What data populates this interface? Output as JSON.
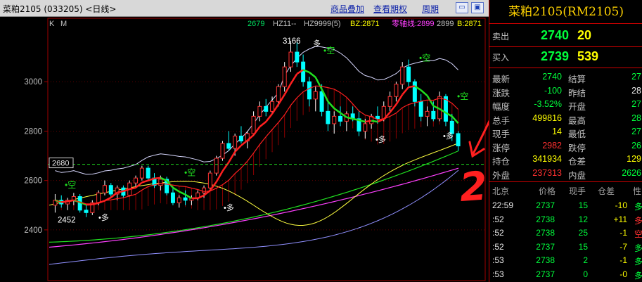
{
  "window": {
    "title": "菜粕2105 (033205) <日线>",
    "buttons": [
      "商品叠加",
      "查看期权",
      "周期"
    ],
    "icon_buttons": [
      "zoom-out-icon",
      "zoom-in-icon"
    ]
  },
  "indicator_bar": {
    "left": "K",
    "left2": "M",
    "values": [
      {
        "text": "2679",
        "color": "#00e060"
      },
      {
        "text": "HZ11--",
        "color": "#c0c0c0"
      },
      {
        "text": "HZ9999(5)",
        "color": "#c0c0c0"
      },
      {
        "text": "BZ:2871",
        "color": "#ffff00"
      },
      {
        "text": "零轴线:2899",
        "color": "#ff40ff"
      },
      {
        "text": "2899",
        "color": "#c0c0c0"
      },
      {
        "text": "B:2871",
        "color": "#ffff00"
      }
    ]
  },
  "chart_data": {
    "type": "candlestick",
    "y_ticks": [
      3000,
      2800,
      2600,
      2400
    ],
    "ylim": [
      2300,
      3200
    ],
    "price_box": "2680",
    "annotations": {
      "high": "3166",
      "low": "2452",
      "kong": "空",
      "duo": "多",
      "handwritten": "2680"
    },
    "candles": [
      [
        2500,
        2545,
        2470,
        2520
      ],
      [
        2520,
        2540,
        2490,
        2505
      ],
      [
        2505,
        2530,
        2480,
        2520
      ],
      [
        2520,
        2550,
        2500,
        2535
      ],
      [
        2535,
        2545,
        2470,
        2480
      ],
      [
        2480,
        2500,
        2452,
        2470
      ],
      [
        2470,
        2520,
        2460,
        2510
      ],
      [
        2510,
        2560,
        2500,
        2550
      ],
      [
        2550,
        2600,
        2540,
        2580
      ],
      [
        2580,
        2590,
        2530,
        2545
      ],
      [
        2545,
        2580,
        2520,
        2570
      ],
      [
        2570,
        2580,
        2530,
        2540
      ],
      [
        2540,
        2600,
        2535,
        2590
      ],
      [
        2590,
        2620,
        2570,
        2610
      ],
      [
        2610,
        2660,
        2600,
        2650
      ],
      [
        2650,
        2660,
        2600,
        2610
      ],
      [
        2610,
        2630,
        2570,
        2580
      ],
      [
        2580,
        2620,
        2560,
        2605
      ],
      [
        2605,
        2615,
        2540,
        2550
      ],
      [
        2550,
        2570,
        2500,
        2510
      ],
      [
        2510,
        2540,
        2490,
        2530
      ],
      [
        2530,
        2560,
        2500,
        2520
      ],
      [
        2520,
        2540,
        2500,
        2530
      ],
      [
        2530,
        2560,
        2520,
        2550
      ],
      [
        2550,
        2580,
        2530,
        2570
      ],
      [
        2570,
        2640,
        2560,
        2630
      ],
      [
        2630,
        2700,
        2620,
        2690
      ],
      [
        2690,
        2760,
        2680,
        2750
      ],
      [
        2750,
        2800,
        2720,
        2730
      ],
      [
        2730,
        2790,
        2700,
        2780
      ],
      [
        2780,
        2820,
        2750,
        2760
      ],
      [
        2760,
        2800,
        2730,
        2790
      ],
      [
        2790,
        2880,
        2780,
        2860
      ],
      [
        2860,
        2920,
        2840,
        2900
      ],
      [
        2900,
        2930,
        2860,
        2880
      ],
      [
        2880,
        2940,
        2870,
        2920
      ],
      [
        2920,
        2990,
        2900,
        2980
      ],
      [
        2980,
        3080,
        2960,
        3060
      ],
      [
        3060,
        3166,
        3040,
        3120
      ],
      [
        3120,
        3160,
        3060,
        3080
      ],
      [
        3080,
        3110,
        2980,
        3000
      ],
      [
        3000,
        3020,
        2900,
        2930
      ],
      [
        2930,
        2980,
        2880,
        2960
      ],
      [
        2960,
        2990,
        2860,
        2880
      ],
      [
        2880,
        2920,
        2800,
        2830
      ],
      [
        2830,
        2880,
        2790,
        2860
      ],
      [
        2860,
        2900,
        2820,
        2840
      ],
      [
        2840,
        2880,
        2800,
        2870
      ],
      [
        2870,
        2900,
        2840,
        2850
      ],
      [
        2850,
        2880,
        2780,
        2800
      ],
      [
        2800,
        2850,
        2770,
        2830
      ],
      [
        2830,
        2870,
        2810,
        2860
      ],
      [
        2860,
        2900,
        2830,
        2850
      ],
      [
        2850,
        2920,
        2840,
        2900
      ],
      [
        2900,
        2960,
        2880,
        2940
      ],
      [
        2940,
        3000,
        2920,
        2990
      ],
      [
        2990,
        3080,
        2970,
        3060
      ],
      [
        3060,
        3090,
        2980,
        3000
      ],
      [
        3000,
        3010,
        2900,
        2920
      ],
      [
        2920,
        2950,
        2840,
        2860
      ],
      [
        2860,
        2900,
        2820,
        2880
      ],
      [
        2880,
        2920,
        2840,
        2850
      ],
      [
        2850,
        2960,
        2840,
        2940
      ],
      [
        2940,
        2950,
        2820,
        2840
      ],
      [
        2840,
        2870,
        2760,
        2790
      ],
      [
        2790,
        2800,
        2720,
        2740
      ]
    ]
  },
  "quote": {
    "title": "菜粕2105(RM2105)",
    "sell": {
      "label": "卖出",
      "price": "2740",
      "vol": "20"
    },
    "buy": {
      "label": "买入",
      "price": "2739",
      "vol": "539"
    },
    "stats": [
      {
        "l1": "最新",
        "v1": "2740",
        "c1": "green",
        "l2": "结算",
        "v2": "27",
        "c2": "green"
      },
      {
        "l1": "涨跌",
        "v1": "-100",
        "c1": "green",
        "l2": "昨结",
        "v2": "28",
        "c2": "white"
      },
      {
        "l1": "幅度",
        "v1": "-3.52%",
        "c1": "green",
        "l2": "开盘",
        "v2": "27",
        "c2": "green"
      },
      {
        "l1": "总手",
        "v1": "499816",
        "c1": "yellow",
        "l2": "最高",
        "v2": "28",
        "c2": "green"
      },
      {
        "l1": "现手",
        "v1": "14",
        "c1": "yellow",
        "l2": "最低",
        "v2": "27",
        "c2": "green"
      },
      {
        "l1": "涨停",
        "v1": "2982",
        "c1": "red",
        "l2": "跌停",
        "v2": "26",
        "c2": "green"
      },
      {
        "l1": "持仓",
        "v1": "341934",
        "c1": "yellow",
        "l2": "仓差",
        "v2": "129",
        "c2": "yellow"
      },
      {
        "l1": "外盘",
        "v1": "237313",
        "c1": "red",
        "l2": "内盘",
        "v2": "2626",
        "c2": "green"
      }
    ],
    "tick_header": [
      "北京",
      "价格",
      "现手",
      "仓差",
      "性"
    ],
    "ticks": [
      {
        "time": "22:59",
        "price": "2737",
        "vol": "15",
        "oi": "-10",
        "oi_c": "yellow",
        "t": "多",
        "t_c": "green"
      },
      {
        "time": ":52",
        "price": "2738",
        "vol": "12",
        "oi": "+11",
        "oi_c": "yellow",
        "t": "多",
        "t_c": "red"
      },
      {
        "time": ":52",
        "price": "2738",
        "vol": "25",
        "oi": "-1",
        "oi_c": "yellow",
        "t": "空",
        "t_c": "red"
      },
      {
        "time": ":52",
        "price": "2737",
        "vol": "15",
        "oi": "-7",
        "oi_c": "yellow",
        "t": "多",
        "t_c": "green"
      },
      {
        "time": ":53",
        "price": "2738",
        "vol": "2",
        "oi": "-1",
        "oi_c": "yellow",
        "t": "多",
        "t_c": "green"
      },
      {
        "time": ":53",
        "price": "2737",
        "vol": "0",
        "oi": "-0",
        "oi_c": "yellow",
        "t": "多",
        "t_c": "green"
      }
    ]
  },
  "colors": {
    "up": "#ff3030",
    "down": "#00ffff",
    "ma_yellow": "#ffff40",
    "ma_green": "#20e020",
    "ma_red": "#ff2020",
    "ma_purple": "#9090ff",
    "ma_magenta": "#ff40ff",
    "annotation_red": "#ff2020"
  }
}
